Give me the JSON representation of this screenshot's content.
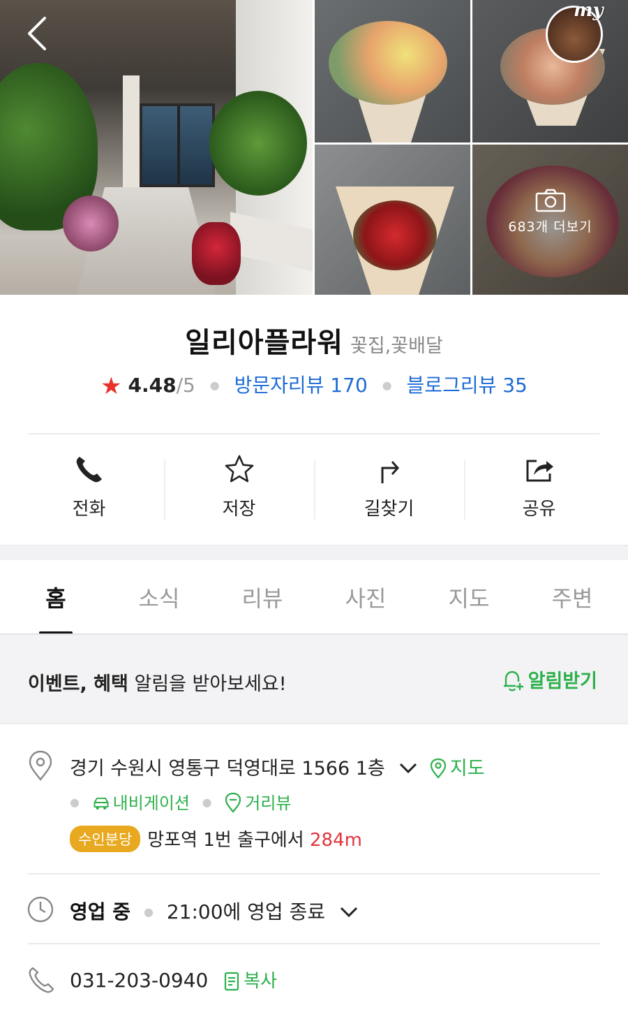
{
  "photos": {
    "more_count_label": "683개 더보기",
    "my_badge": "my"
  },
  "store": {
    "name": "일리아플라워",
    "category": "꽃집,꽃배달",
    "rating": "4.48",
    "rating_max": "/5",
    "visitor_reviews": "방문자리뷰 170",
    "blog_reviews": "블로그리뷰 35"
  },
  "actions": [
    {
      "label": "전화",
      "icon": "phone-icon"
    },
    {
      "label": "저장",
      "icon": "star-outline-icon"
    },
    {
      "label": "길찾기",
      "icon": "turn-arrow-icon"
    },
    {
      "label": "공유",
      "icon": "share-icon"
    }
  ],
  "tabs": [
    {
      "label": "홈",
      "active": true
    },
    {
      "label": "소식"
    },
    {
      "label": "리뷰"
    },
    {
      "label": "사진"
    },
    {
      "label": "지도"
    },
    {
      "label": "주변"
    }
  ],
  "event_banner": {
    "bold_text": "이벤트, 혜택",
    "rest_text": " 알림을 받아보세요!",
    "notify_label": "알림받기"
  },
  "address": {
    "text": "경기 수원시 영통구 덕영대로 1566 1층",
    "map_link": "지도",
    "navigation_link": "내비게이션",
    "street_view_link": "거리뷰"
  },
  "subway": {
    "line": "수인분당",
    "description": "망포역 1번 출구에서",
    "distance": "284m"
  },
  "hours": {
    "status": "영업 중",
    "detail": "21:00에 영업 종료"
  },
  "phone": {
    "number": "031-203-0940",
    "copy_label": "복사"
  },
  "colors": {
    "accent_green": "#2cb04b",
    "link_blue": "#1d6bd6",
    "star_red": "#e8322b",
    "subway_yellow": "#e8a81f",
    "distance_red": "#e0353b"
  }
}
